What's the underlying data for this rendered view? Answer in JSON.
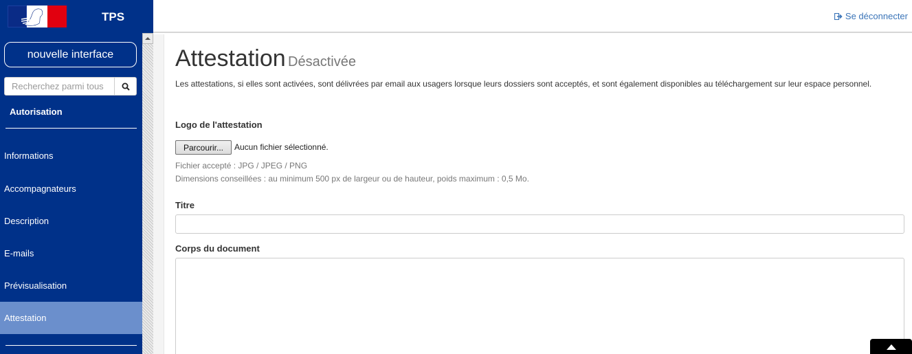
{
  "header": {
    "app_name": "TPS",
    "logout_label": "Se déconnecter"
  },
  "sidebar": {
    "new_interface_label": "nouvelle interface",
    "search_placeholder": "Recherchez parmi tous",
    "section_title": "Autorisation",
    "items": [
      {
        "label": "Informations",
        "active": false
      },
      {
        "label": "Accompagnateurs",
        "active": false
      },
      {
        "label": "Description",
        "active": false
      },
      {
        "label": "E-mails",
        "active": false
      },
      {
        "label": "Prévisualisation",
        "active": false
      },
      {
        "label": "Attestation",
        "active": true
      }
    ]
  },
  "main": {
    "title": "Attestation",
    "status": "Désactivée",
    "intro": "Les attestations, si elles sont activées, sont délivrées par email aux usagers lorsque leurs dossiers sont acceptés, et sont également disponibles au téléchargement sur leur espace personnel.",
    "logo_label": "Logo de l'attestation",
    "browse_label": "Parcourir...",
    "no_file_label": "Aucun fichier sélectionné.",
    "file_help_1": "Fichier accepté : JPG / JPEG / PNG",
    "file_help_2": "Dimensions conseillées : au minimum 500 px de largeur ou de hauteur, poids maximum : 0,5 Mo.",
    "title_label": "Titre",
    "title_value": "",
    "body_label": "Corps du document",
    "body_value": ""
  },
  "colors": {
    "sidebar_bg": "#003189",
    "active_item_bg": "#6b8fcc",
    "link": "#3a74b8"
  }
}
